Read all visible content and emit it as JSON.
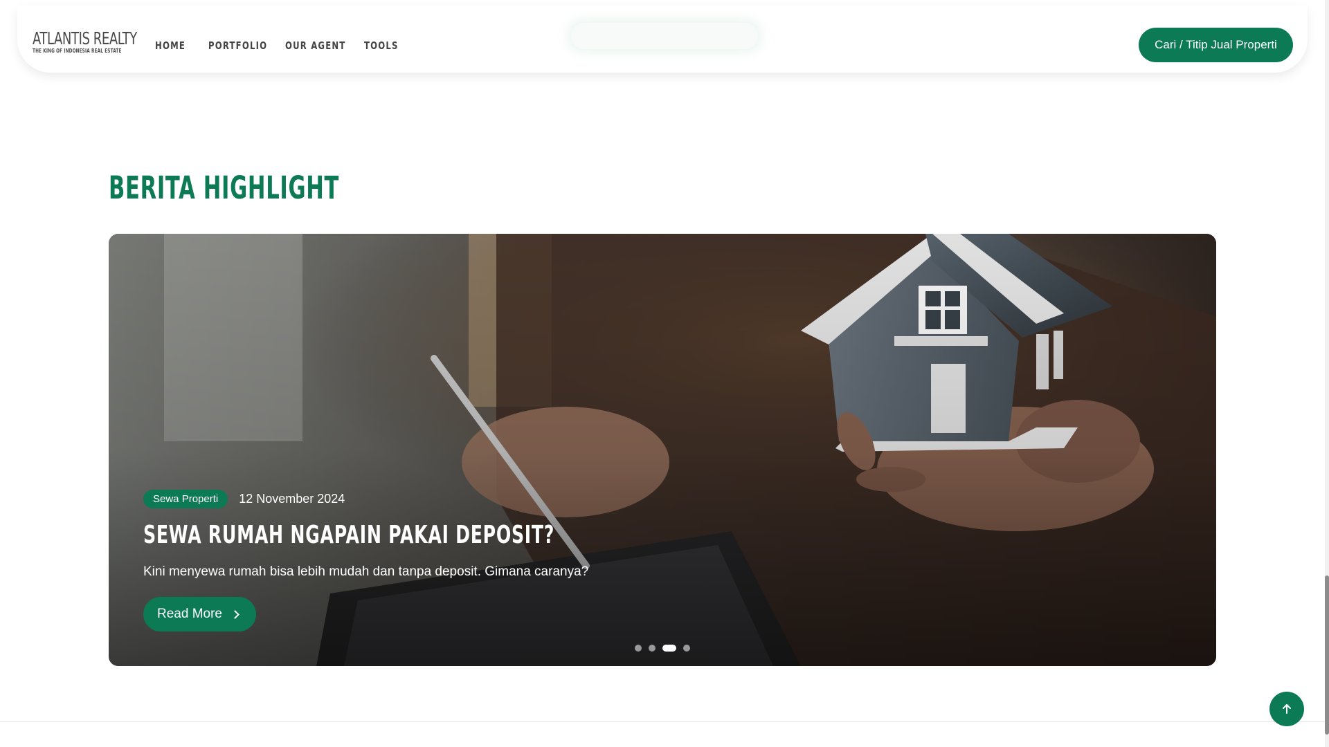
{
  "brand": {
    "name": "ATLANTIS REALTY",
    "tagline": "THE KING OF INDONESIA REAL ESTATE",
    "accent_color": "#0b7a55"
  },
  "nav": {
    "items": [
      {
        "label": "HOME"
      },
      {
        "label": "PORTFOLIO"
      },
      {
        "label": "OUR AGENT"
      },
      {
        "label": "TOOLS"
      }
    ],
    "cta_label": "Cari / Titip Jual Properti"
  },
  "section": {
    "title": "BERITA HIGHLIGHT"
  },
  "highlight": {
    "category": "Sewa Properti",
    "date": "12 November 2024",
    "title": "SEWA RUMAH NGAPAIN PAKAI DEPOSIT?",
    "excerpt": "Kini menyewa rumah bisa lebih mudah dan tanpa deposit. Gimana caranya?",
    "read_more_label": "Read More",
    "carousel": {
      "slide_count": 4,
      "active_index": 2
    }
  },
  "icons": {
    "read_more": "chevron-right-icon",
    "back_to_top": "arrow-up-icon"
  }
}
